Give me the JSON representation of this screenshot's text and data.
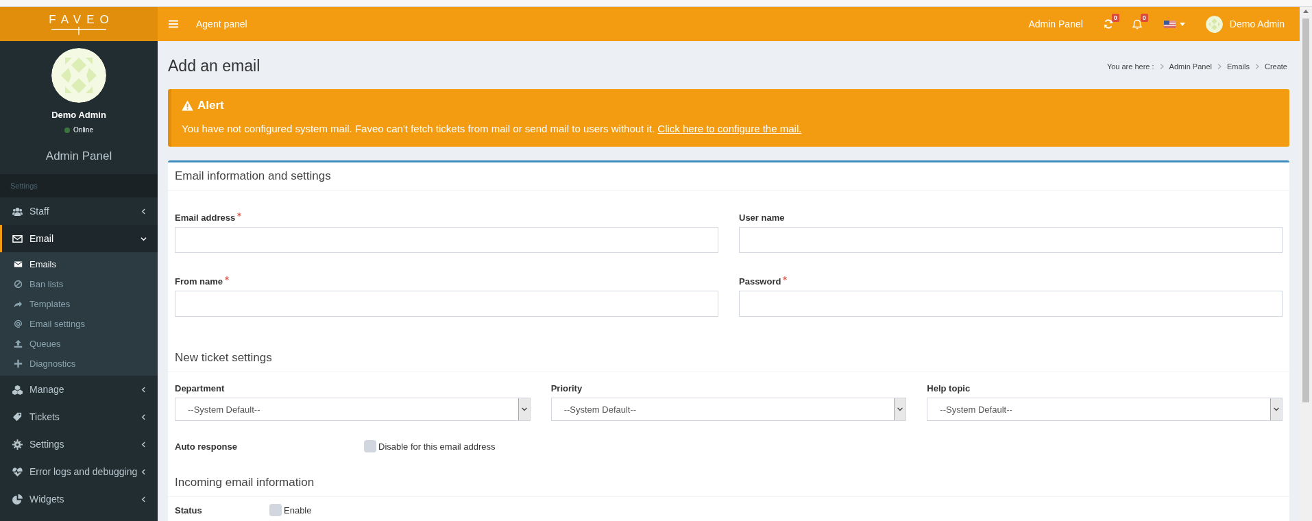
{
  "header": {
    "logo": "FAVEO",
    "agent_link": "Agent panel",
    "admin_link": "Admin Panel",
    "sync_count": "0",
    "notification_count": "0",
    "user_name": "Demo Admin"
  },
  "sidebar": {
    "user_name": "Demo Admin",
    "status": "Online",
    "panel_title": "Admin Panel",
    "section": "Settings",
    "items": [
      {
        "label": "Staff",
        "selected": false,
        "expanded": false
      },
      {
        "label": "Email",
        "selected": true,
        "expanded": true,
        "children": [
          {
            "label": "Emails",
            "selected": true
          },
          {
            "label": "Ban lists",
            "selected": false
          },
          {
            "label": "Templates",
            "selected": false
          },
          {
            "label": "Email settings",
            "selected": false
          },
          {
            "label": "Queues",
            "selected": false
          },
          {
            "label": "Diagnostics",
            "selected": false
          }
        ]
      },
      {
        "label": "Manage",
        "selected": false,
        "expanded": false
      },
      {
        "label": "Tickets",
        "selected": false,
        "expanded": false
      },
      {
        "label": "Settings",
        "selected": false,
        "expanded": false
      },
      {
        "label": "Error logs and debugging",
        "selected": false,
        "expanded": false
      },
      {
        "label": "Widgets",
        "selected": false,
        "expanded": false
      }
    ]
  },
  "page": {
    "title": "Add an email",
    "breadcrumb": [
      "You are here :",
      "Admin Panel",
      "Emails",
      "Create"
    ]
  },
  "alert": {
    "title": "Alert",
    "message": "You have not configured system mail. Faveo can't fetch tickets from mail or send mail to users without it.",
    "link": "Click here to configure the mail."
  },
  "email_info": {
    "title": "Email information and settings",
    "fields": [
      {
        "label": "Email address",
        "required": true
      },
      {
        "label": "User name",
        "required": false
      },
      {
        "label": "From name",
        "required": true
      },
      {
        "label": "Password",
        "required": true
      }
    ]
  },
  "new_ticket": {
    "title": "New ticket settings",
    "selects": [
      {
        "label": "Department",
        "value": "--System Default--"
      },
      {
        "label": "Priority",
        "value": "--System Default--"
      },
      {
        "label": "Help topic",
        "value": "--System Default--"
      }
    ],
    "auto_response": {
      "label": "Auto response",
      "option": "Disable for this email address",
      "checked": false
    }
  },
  "incoming": {
    "title": "Incoming email information",
    "status": {
      "label": "Status",
      "option": "Enable",
      "checked": false
    }
  }
}
